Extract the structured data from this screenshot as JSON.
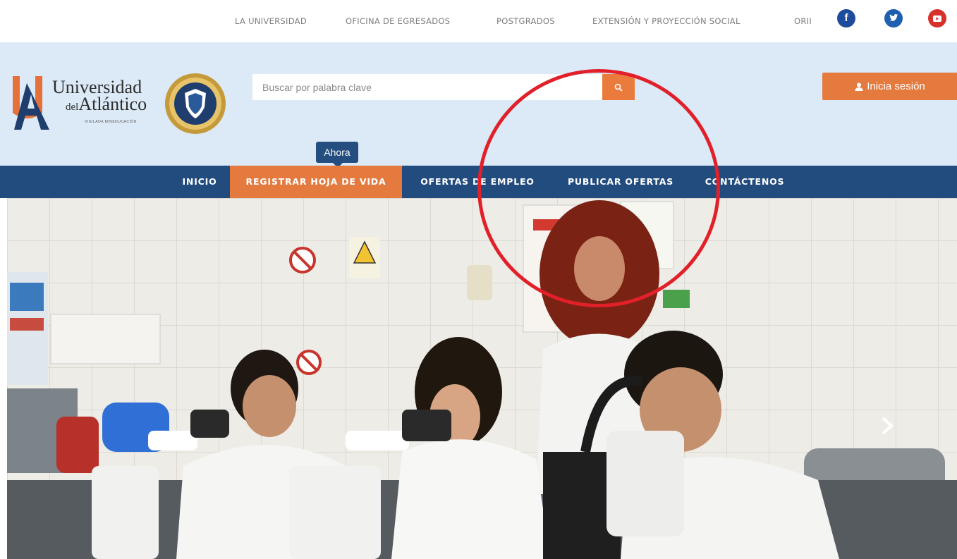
{
  "topbar": {
    "links": [
      "LA UNIVERSIDAD",
      "OFICINA DE EGRESADOS",
      "POSTGRADOS",
      "EXTENSIÓN Y PROYECCIÓN SOCIAL",
      "ORII"
    ],
    "social": {
      "facebook": "f",
      "twitter": "twitter-icon",
      "youtube": "youtube-icon"
    }
  },
  "header": {
    "logo": {
      "line1": "Universidad",
      "line2_small": "del",
      "line2": "Atlántico",
      "tagline": "VIGILADA MINEDUCACIÓN"
    },
    "search": {
      "placeholder": "Buscar por palabra clave"
    },
    "login_label": "Inicia sesión",
    "ahora_label": "Ahora"
  },
  "nav": {
    "items": [
      {
        "label": "INICIO"
      },
      {
        "label": "REGISTRAR HOJA DE VIDA"
      },
      {
        "label": "OFERTAS DE EMPLEO"
      },
      {
        "label": "PUBLICAR OFERTAS"
      },
      {
        "label": "CONTÁCTENOS"
      }
    ],
    "active_index": 1
  },
  "colors": {
    "nav_bg": "#234c7e",
    "accent_orange": "#e57a3e",
    "header_bg": "#dce9f6",
    "annotation_red": "#e1202a"
  },
  "icons": {
    "search": "search-icon",
    "user": "user-icon",
    "carousel_next": "chevron-right-icon"
  }
}
